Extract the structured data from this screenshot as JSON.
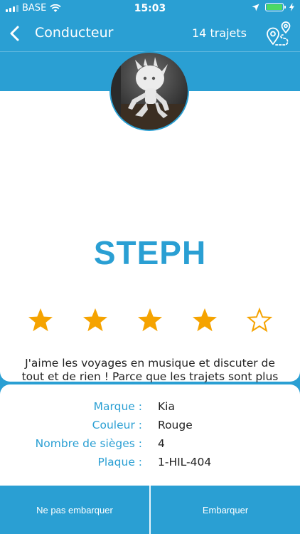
{
  "status_bar": {
    "carrier": "BASE",
    "time": "15:03"
  },
  "nav": {
    "title": "Conducteur",
    "trips_count": "14 trajets"
  },
  "driver": {
    "name": "STEPH",
    "rating": 4,
    "rating_max": 5,
    "bio": "J'aime les voyages en musique et discuter de tout et de rien ! Parce que les trajets sont plus fun à plusieurs !"
  },
  "vehicle": [
    {
      "label": "Marque :",
      "value": "Kia"
    },
    {
      "label": "Couleur :",
      "value": "Rouge"
    },
    {
      "label": "Nombre de sièges :",
      "value": "4"
    },
    {
      "label": "Plaque :",
      "value": "1-HIL-404"
    }
  ],
  "actions": {
    "decline_label": "Ne pas embarquer",
    "accept_label": "Embarquer"
  },
  "colors": {
    "primary": "#2a9fd3",
    "star": "#f5a300",
    "battery": "#4cd964"
  },
  "icons": [
    "back-chevron-icon",
    "map-route-icon",
    "star-icon",
    "wifi-icon",
    "location-arrow-icon",
    "battery-icon"
  ]
}
